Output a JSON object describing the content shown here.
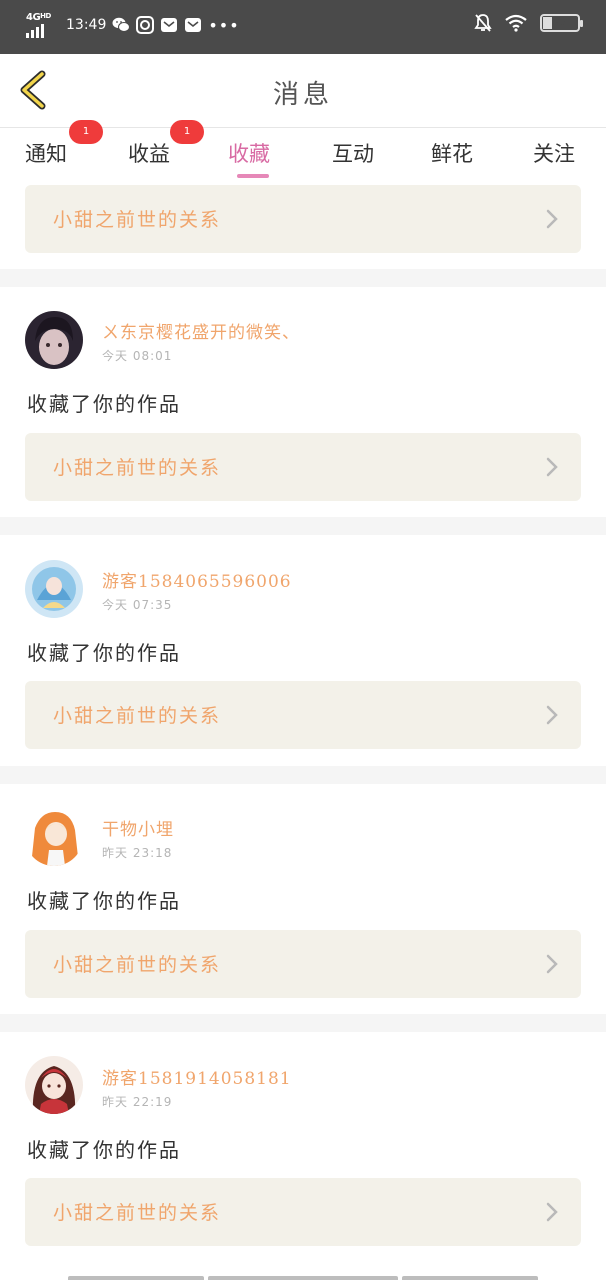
{
  "status_bar": {
    "network": "4G",
    "network_sup": "HD",
    "time": "13:49",
    "more": "•••",
    "battery": "25"
  },
  "header": {
    "title": "消息"
  },
  "tabs": [
    {
      "label": "通知",
      "badge": "1"
    },
    {
      "label": "收益",
      "badge": "1"
    },
    {
      "label": "收藏",
      "active": true
    },
    {
      "label": "互动"
    },
    {
      "label": "鲜花"
    },
    {
      "label": "关注"
    }
  ],
  "top_card": {
    "title": "小甜之前世的关系"
  },
  "messages": [
    {
      "username": "ㄨ东京樱花盛开的微笑、",
      "time": "今天 08:01",
      "action": "收藏了你的作品",
      "work_title": "小甜之前世的关系"
    },
    {
      "username": "游客1584065596006",
      "time": "今天 07:35",
      "action": "收藏了你的作品",
      "work_title": "小甜之前世的关系"
    },
    {
      "username": "干物小埋",
      "time": "昨天 23:18",
      "action": "收藏了你的作品",
      "work_title": "小甜之前世的关系"
    },
    {
      "username": "游客1581914058181",
      "time": "昨天 22:19",
      "action": "收藏了你的作品",
      "work_title": "小甜之前世的关系"
    }
  ],
  "colors": {
    "accent_pink": "#d86aa3",
    "username_orange": "#f0a56c",
    "badge_red": "#ef3b3b",
    "card_bg": "#f3f1e9"
  }
}
